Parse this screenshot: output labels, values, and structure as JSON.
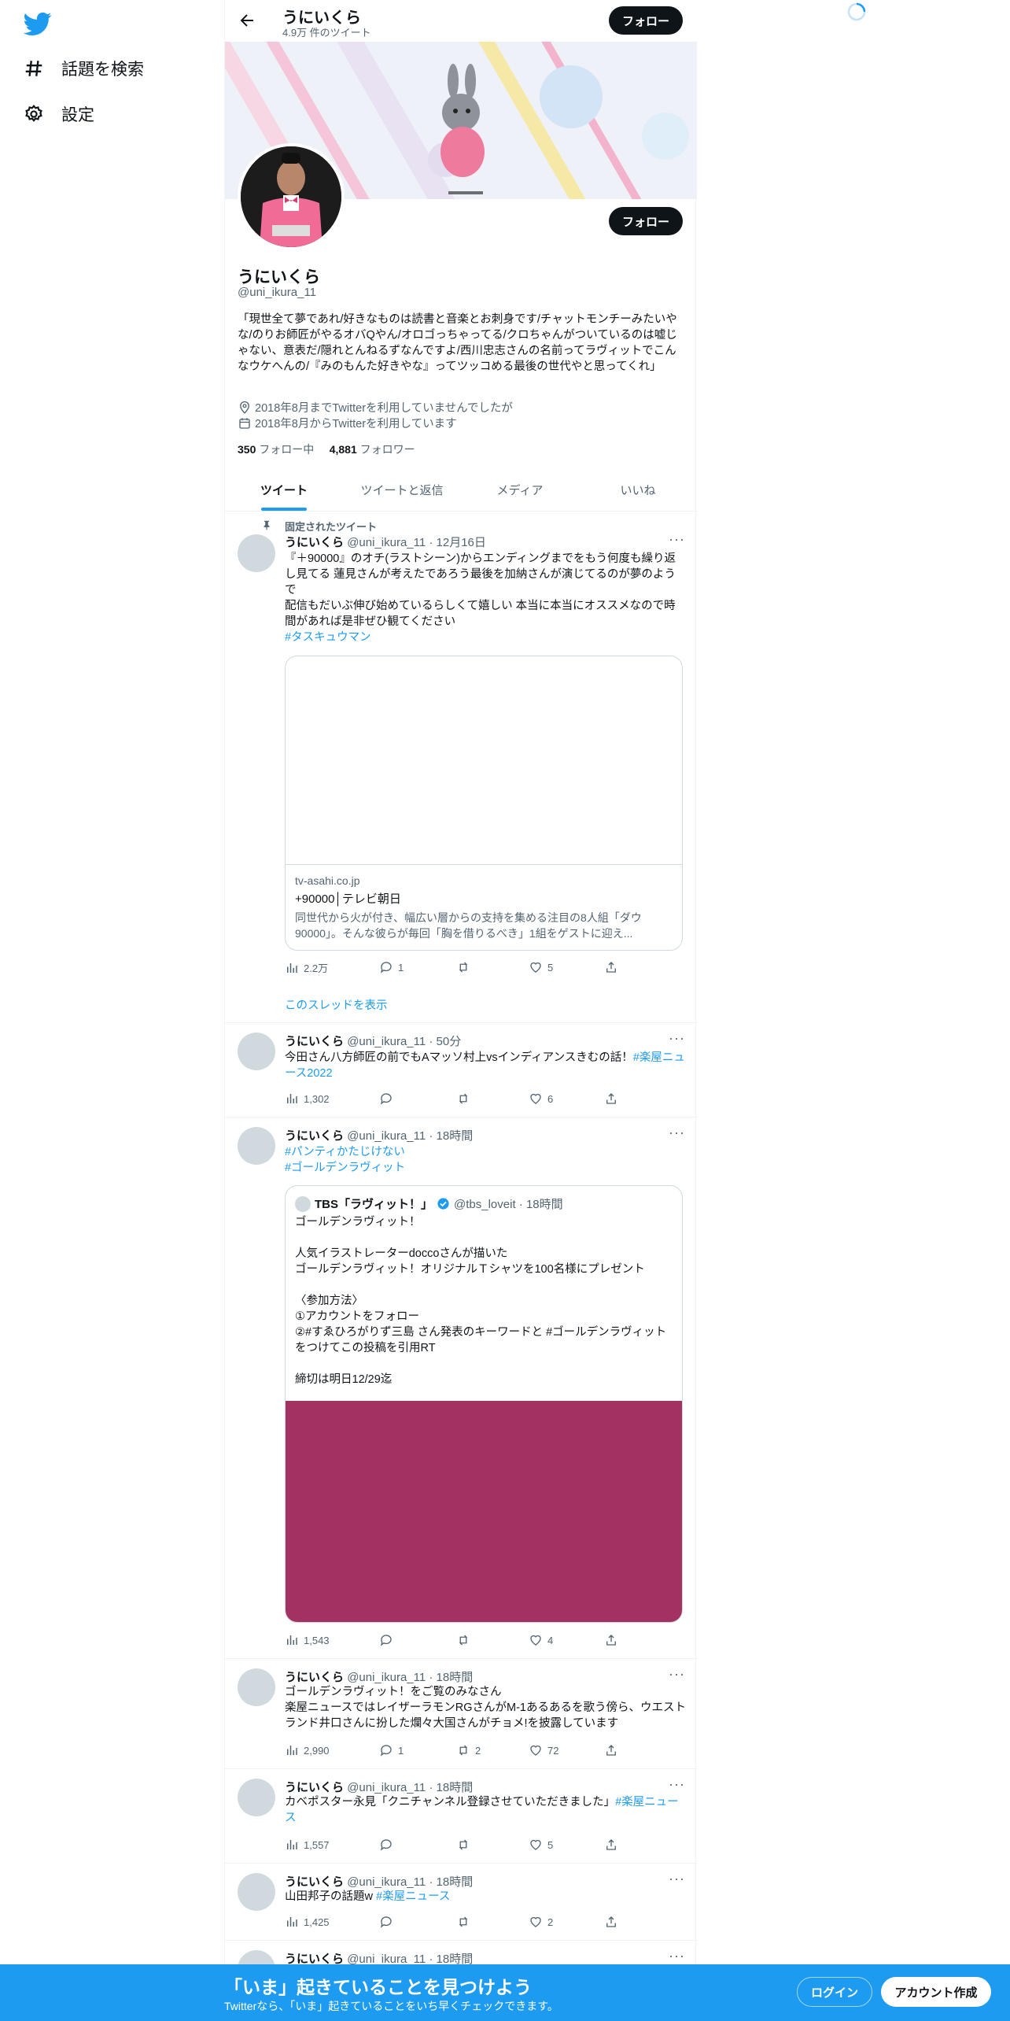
{
  "nav": {
    "explore_label": "話題を検索",
    "settings_label": "設定"
  },
  "topbar": {
    "name": "うにいくら",
    "tweet_count": "4.9万 件のツイート",
    "follow_label": "フォロー"
  },
  "profile": {
    "name": "うにいくら",
    "handle": "@uni_ikura_11",
    "follow_label": "フォロー",
    "bio": "「現世全て夢であれ/好きなものは読書と音楽とお刺身です/チャットモンチーみたいやな/のりお師匠がやるオバQやん/オロゴっちゃってる/クロちゃんがついているのは嘘じゃない、意表だ/隠れとんねるずなんですよ/西川忠志さんの名前ってラヴィットでこんなウケへんの/『みのもんた好きやな』ってツッコめる最後の世代やと思ってくれ」",
    "location": "2018年8月までTwitterを利用していませんでしたが",
    "joined": "2018年8月からTwitterを利用しています",
    "following_count": "350",
    "following_label": "フォロー中",
    "followers_count": "4,881",
    "followers_label": "フォロワー"
  },
  "tabs": [
    {
      "label": "ツイート",
      "active": true
    },
    {
      "label": "ツイートと返信",
      "active": false
    },
    {
      "label": "メディア",
      "active": false
    },
    {
      "label": "いいね",
      "active": false
    }
  ],
  "tweets": [
    {
      "pinned_label": "固定されたツイート",
      "name": "うにいくら",
      "handle_time": "@uni_ikura_11 · 12月16日",
      "text": "『＋90000』のオチ(ラストシーン)からエンディングまでをもう何度も繰り返し見てる 蓮見さんが考えたであろう最後を加納さんが演じてるのが夢のようで\n配信もだいぶ伸び始めているらしくて嬉しい 本当に本当にオススメなので時間があれば是非ぜひ観てください",
      "tag": "#タスキュウマン",
      "card_domain": "tv-asahi.co.jp",
      "card_title": "+90000│テレビ朝日",
      "card_desc": "同世代から火が付き、幅広い層からの支持を集める注目の8人組「ダウ90000」。そんな彼らが毎回「胸を借りるべき」1組をゲストに迎え...",
      "views": "2.2万",
      "replies": "1",
      "retweets": "",
      "likes": "5",
      "show_thread": "このスレッドを表示"
    },
    {
      "name": "うにいくら",
      "handle_time": "@uni_ikura_11 · 50分",
      "text": "今田さん八方師匠の前でもAマッソ村上vsインディアンスきむの話！",
      "tag": "#楽屋ニュース2022",
      "views": "1,302",
      "replies": "",
      "retweets": "",
      "likes": "6"
    },
    {
      "name": "うにいくら",
      "handle_time": "@uni_ikura_11 · 18時間",
      "tag1": "#パンティかたじけない",
      "tag2": "#ゴールデンラヴィット",
      "quote_name": "TBS「ラヴィット！」",
      "quote_handle_time": "@tbs_loveit · 18時間",
      "quote_text": "ゴールデンラヴィット！\n\n人気イラストレーターdoccoさんが描いた\nゴールデンラヴィット！オリジナルＴシャツを100名様にプレゼント\n\n〈参加方法〉\n①アカウントをフォロー\n②#すゑひろがりず三島 さん発表のキーワードと #ゴールデンラヴィット をつけてこの投稿を引用RT\n\n締切は明日12/29迄",
      "views": "1,543",
      "replies": "",
      "retweets": "",
      "likes": "4",
      "media_color": "#a33263"
    },
    {
      "name": "うにいくら",
      "handle_time": "@uni_ikura_11 · 18時間",
      "text": "ゴールデンラヴィット！をご覧のみなさん\n楽屋ニュースではレイザーラモンRGさんがM-1あるあるを歌う傍ら、ウエストランド井口さんに扮した爛々大国さんがチョメ!を披露しています",
      "views": "2,990",
      "replies": "1",
      "retweets": "2",
      "likes": "72"
    },
    {
      "name": "うにいくら",
      "handle_time": "@uni_ikura_11 · 18時間",
      "text": "カベポスター永見「クニチャンネル登録させていただきました」",
      "tag": "#楽屋ニュース",
      "views": "1,557",
      "replies": "",
      "retweets": "",
      "likes": "5"
    },
    {
      "name": "うにいくら",
      "handle_time": "@uni_ikura_11 · 18時間",
      "text": "山田邦子の話題w",
      "tag": "#楽屋ニュース",
      "views": "1,425",
      "replies": "",
      "retweets": "",
      "likes": "2"
    },
    {
      "name": "うにいくら",
      "handle_time": "@uni_ikura_11 · 18時間"
    }
  ],
  "bottombar": {
    "title": "「いま」起きていることを見つけよう",
    "subtitle": "Twitterなら、「いま」起きていることをいち早くチェックできます。",
    "login_label": "ログイン",
    "signup_label": "アカウント作成"
  },
  "colors": {
    "accent": "#1d9bf0",
    "text": "#0f1419",
    "muted": "#536471",
    "bottombar": "#1d9bf0"
  }
}
